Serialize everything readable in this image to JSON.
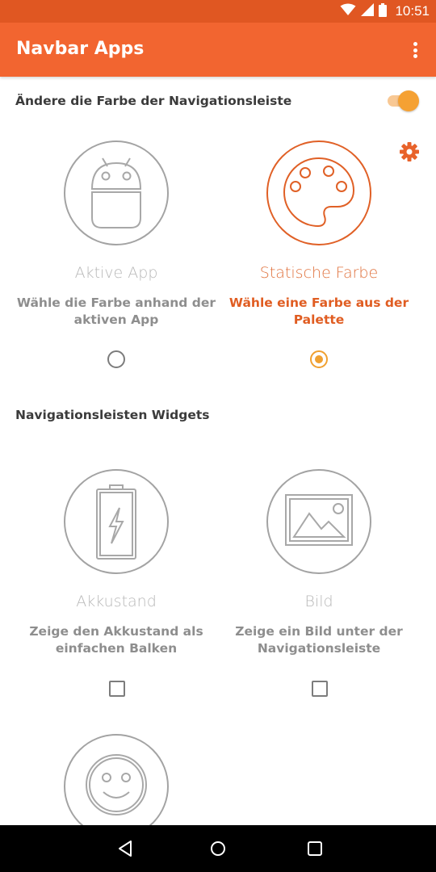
{
  "status_bar": {
    "time": "10:51",
    "icons": [
      "wifi-icon",
      "signal-icon",
      "battery-icon"
    ]
  },
  "app_bar": {
    "title": "Navbar Apps",
    "menu_icon": "overflow-menu-icon"
  },
  "color_section": {
    "title": "Ändere die Farbe der Navigationsleiste",
    "toggle_on": true,
    "settings_icon": "gear-icon",
    "options": [
      {
        "icon": "android-robot-icon",
        "title": "Aktive App",
        "description_line1": "Wähle die Farbe anhand der",
        "description_line2": "aktiven App",
        "selected": false
      },
      {
        "icon": "palette-icon",
        "title": "Statische Farbe",
        "description_line1": "Wähle eine Farbe aus der",
        "description_line2": "Palette",
        "selected": true
      }
    ]
  },
  "widgets_section": {
    "title": "Navigationsleisten Widgets",
    "widgets": [
      {
        "icon": "battery-charging-icon",
        "title": "Akkustand",
        "description_line1": "Zeige den Akkustand als",
        "description_line2": "einfachen Balken",
        "checked": false
      },
      {
        "icon": "image-icon",
        "title": "Bild",
        "description_line1": "Zeige ein Bild unter der",
        "description_line2": "Navigationsleiste",
        "checked": false
      },
      {
        "icon": "smiley-icon"
      }
    ]
  },
  "colors": {
    "status_bar": "#e05722",
    "app_bar": "#f26530",
    "accent": "#f5a133",
    "selected_text": "#e05d22"
  },
  "nav_bar": {
    "buttons": [
      "back-icon",
      "home-icon",
      "recents-icon"
    ]
  }
}
